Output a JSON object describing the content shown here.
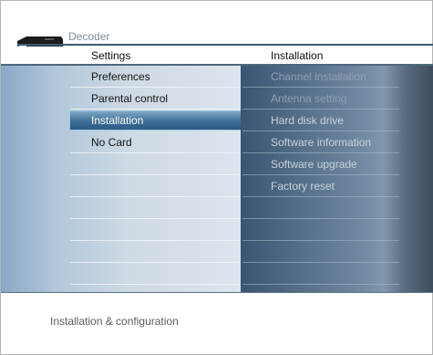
{
  "app": {
    "title": "Decoder"
  },
  "columns": {
    "left_title": "Settings",
    "right_title": "Installation"
  },
  "menu": {
    "items": [
      {
        "label": "Preferences"
      },
      {
        "label": "Parental control"
      },
      {
        "label": "Installation"
      },
      {
        "label": "No Card"
      }
    ],
    "selected": "Installation"
  },
  "submenu": {
    "items": [
      {
        "label": "Channel installation"
      },
      {
        "label": "Antenna setting"
      },
      {
        "label": "Hard disk drive"
      },
      {
        "label": "Software information"
      },
      {
        "label": "Software upgrade"
      },
      {
        "label": "Factory reset"
      }
    ]
  },
  "footer": {
    "description": "Installation & configuration"
  },
  "icons": {
    "device": "set-top-box-icon"
  },
  "colors": {
    "selection": "#3e6e96",
    "header_line": "#3d5a74"
  }
}
